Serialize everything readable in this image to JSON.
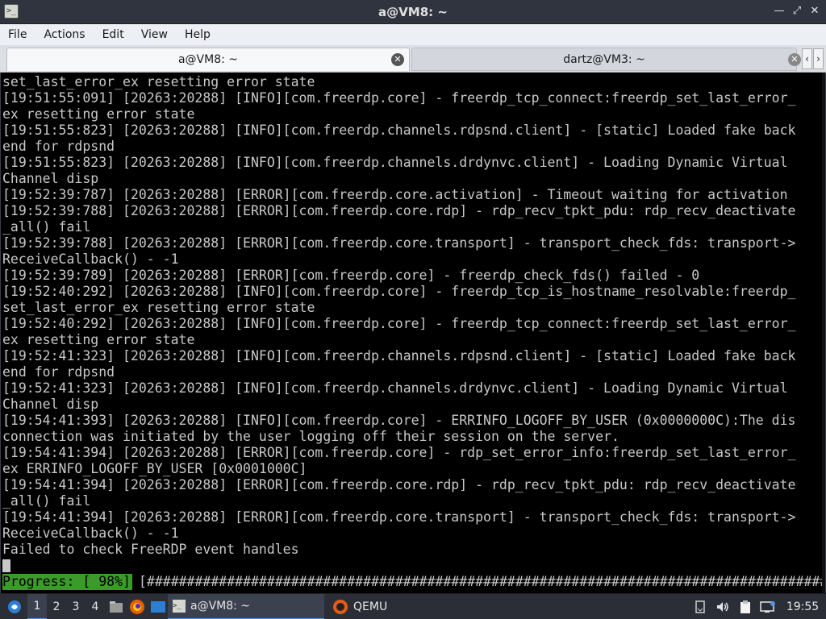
{
  "window": {
    "title": "a@VM8: ~",
    "icon_name": "terminal-icon",
    "buttons": [
      "minimize-icon",
      "maximize-icon",
      "close-icon"
    ]
  },
  "menu": {
    "items": [
      "File",
      "Actions",
      "Edit",
      "View",
      "Help"
    ]
  },
  "tabs": [
    {
      "label": "a@VM8: ~",
      "active": true,
      "close_icon": "close-icon"
    },
    {
      "label": "dartz@VM3: ~",
      "active": false,
      "close_icon": "close-icon"
    }
  ],
  "terminal": {
    "lines": [
      "set_last_error_ex resetting error state",
      "[19:51:55:091] [20263:20288] [INFO][com.freerdp.core] - freerdp_tcp_connect:freerdp_set_last_error_",
      "ex resetting error state",
      "[19:51:55:823] [20263:20288] [INFO][com.freerdp.channels.rdpsnd.client] - [static] Loaded fake back",
      "end for rdpsnd",
      "[19:51:55:823] [20263:20288] [INFO][com.freerdp.channels.drdynvc.client] - Loading Dynamic Virtual",
      "Channel disp",
      "[19:52:39:787] [20263:20288] [ERROR][com.freerdp.core.activation] - Timeout waiting for activation",
      "[19:52:39:788] [20263:20288] [ERROR][com.freerdp.core.rdp] - rdp_recv_tpkt_pdu: rdp_recv_deactivate",
      "_all() fail",
      "[19:52:39:788] [20263:20288] [ERROR][com.freerdp.core.transport] - transport_check_fds: transport->",
      "ReceiveCallback() - -1",
      "[19:52:39:789] [20263:20288] [ERROR][com.freerdp.core] - freerdp_check_fds() failed - 0",
      "[19:52:40:292] [20263:20288] [INFO][com.freerdp.core] - freerdp_tcp_is_hostname_resolvable:freerdp_",
      "set_last_error_ex resetting error state",
      "[19:52:40:292] [20263:20288] [INFO][com.freerdp.core] - freerdp_tcp_connect:freerdp_set_last_error_",
      "ex resetting error state",
      "[19:52:41:323] [20263:20288] [INFO][com.freerdp.channels.rdpsnd.client] - [static] Loaded fake back",
      "end for rdpsnd",
      "[19:52:41:323] [20263:20288] [INFO][com.freerdp.channels.drdynvc.client] - Loading Dynamic Virtual",
      "Channel disp",
      "[19:54:41:393] [20263:20288] [INFO][com.freerdp.core] - ERRINFO_LOGOFF_BY_USER (0x0000000C):The dis",
      "connection was initiated by the user logging off their session on the server.",
      "[19:54:41:394] [20263:20288] [ERROR][com.freerdp.core] - rdp_set_error_info:freerdp_set_last_error_",
      "ex ERRINFO_LOGOFF_BY_USER [0x0001000C]",
      "[19:54:41:394] [20263:20288] [ERROR][com.freerdp.core.rdp] - rdp_recv_tpkt_pdu: rdp_recv_deactivate",
      "_all() fail",
      "[19:54:41:394] [20263:20288] [ERROR][com.freerdp.core.transport] - transport_check_fds: transport->",
      "ReceiveCallback() - -1",
      "Failed to check FreeRDP event handles"
    ],
    "progress": {
      "label": "Progress: [ 98%]",
      "bar": "[#######################################################################################..]",
      "percent": 98,
      "label_color": "#3c9a2b"
    }
  },
  "taskbar": {
    "start_icon": "distro-menu-icon",
    "workspaces": [
      "1",
      "2",
      "3",
      "4"
    ],
    "active_workspace": "1",
    "launchers": [
      "file-manager-icon",
      "firefox-icon",
      "desktop-icon"
    ],
    "windows": [
      {
        "label": "a@VM8: ~",
        "icon": "terminal-icon",
        "active": true
      },
      {
        "label": "QEMU",
        "icon": "qemu-icon",
        "active": false
      }
    ],
    "tray_icons": [
      "notification-icon",
      "volume-icon",
      "clipboard-icon",
      "network-icon"
    ],
    "clock": "19:55"
  },
  "colors": {
    "accent": "#5294e2",
    "terminal_bg": "#000000",
    "terminal_fg": "#c8c8c8",
    "progress_green": "#3c9a2b"
  }
}
